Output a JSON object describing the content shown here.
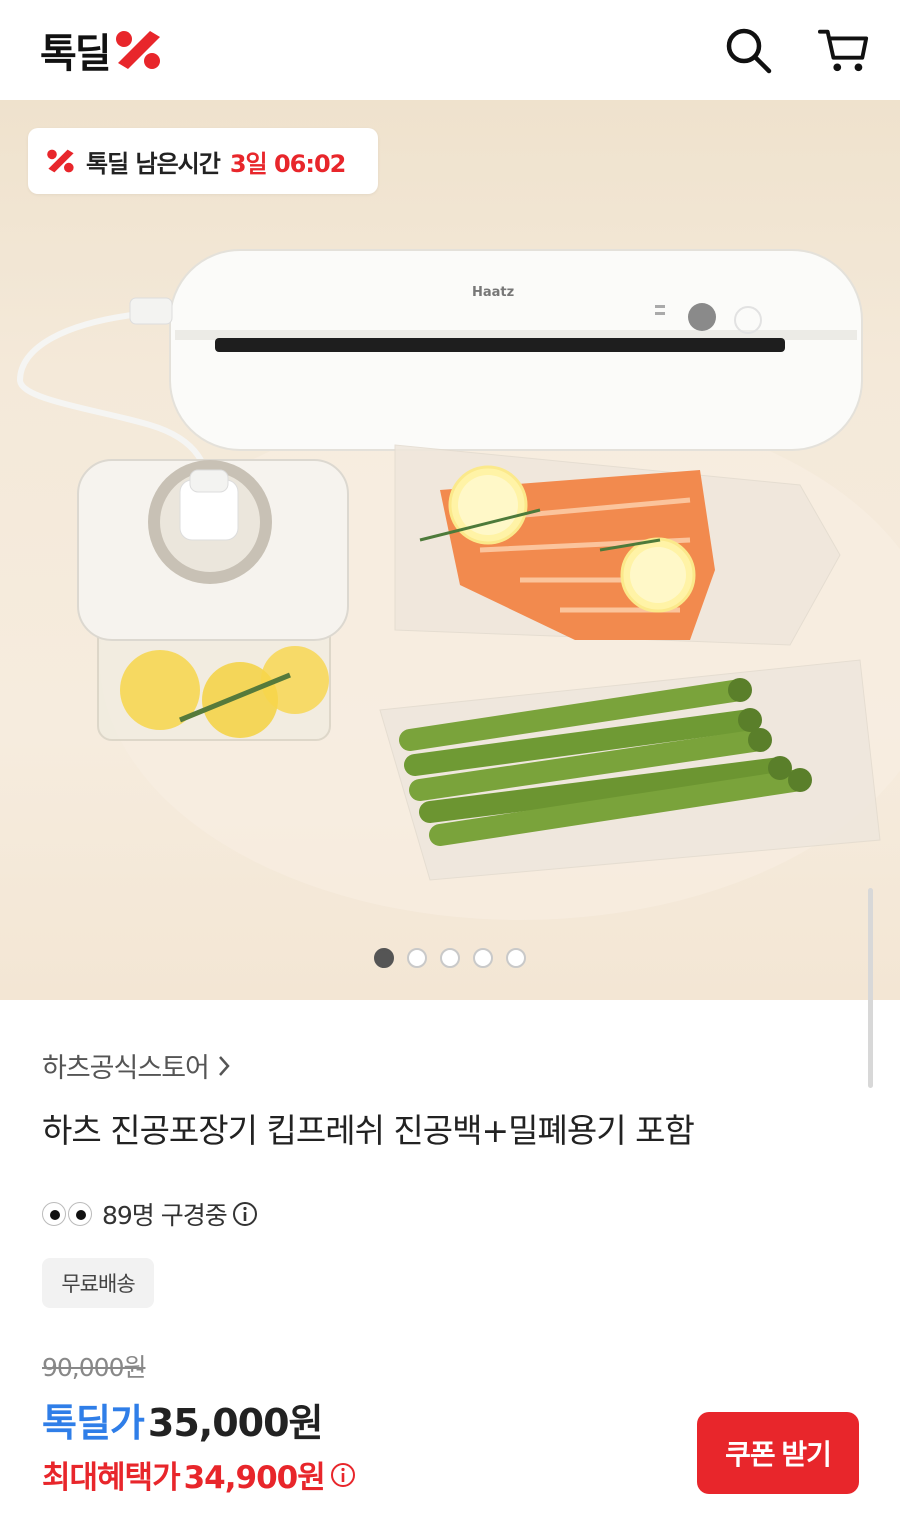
{
  "header": {
    "logo_text": "톡딜",
    "search_icon": "search-icon",
    "cart_icon": "cart-icon"
  },
  "hero": {
    "timer_label": "톡딜 남은시간",
    "timer_value": "3일 06:02",
    "device_brand": "Haatz",
    "carousel_total": 5,
    "carousel_active": 1
  },
  "product": {
    "store_name": "하츠공식스토어",
    "title": "하츠 진공포장기 킵프레쉬 진공백+밀폐용기 포함",
    "viewers_text": "89명 구경중",
    "shipping_badge": "무료배송"
  },
  "price": {
    "original": "90,000원",
    "deal_label": "톡딜가",
    "deal_price": "35,000원",
    "max_label": "최대혜택가",
    "max_price": "34,900원",
    "coupon_button": "쿠폰 받기"
  },
  "colors": {
    "accent_red": "#e8262b",
    "deal_blue": "#2f7ee8"
  }
}
